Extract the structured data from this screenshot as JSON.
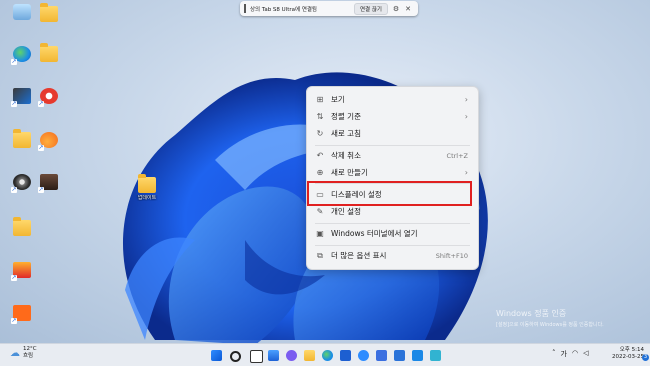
{
  "notification": {
    "text": "상의 Tab S8 Ultra에 연결됨",
    "connect_button": "연결 끊기",
    "settings_icon": "gear-icon",
    "close_icon": "close-icon"
  },
  "desktop": {
    "folder_label": "업데이트"
  },
  "context_menu": {
    "items": [
      {
        "label": "보기",
        "icon": "grid-icon",
        "submenu": true,
        "shortcut": ""
      },
      {
        "label": "정렬 기준",
        "icon": "sort-icon",
        "submenu": true,
        "shortcut": ""
      },
      {
        "label": "새로 고침",
        "icon": "refresh-icon",
        "submenu": false,
        "shortcut": ""
      },
      {
        "label": "삭제 취소",
        "icon": "undo-icon",
        "submenu": false,
        "shortcut": "Ctrl+Z"
      },
      {
        "label": "새로 만들기",
        "icon": "new-icon",
        "submenu": true,
        "shortcut": ""
      },
      {
        "label": "디스플레이 설정",
        "icon": "display-icon",
        "submenu": false,
        "shortcut": ""
      },
      {
        "label": "개인 설정",
        "icon": "brush-icon",
        "submenu": false,
        "shortcut": ""
      },
      {
        "label": "Windows 터미널에서 열기",
        "icon": "terminal-icon",
        "submenu": false,
        "shortcut": ""
      },
      {
        "label": "더 많은 옵션 표시",
        "icon": "more-options-icon",
        "submenu": false,
        "shortcut": "Shift+F10"
      }
    ],
    "highlight_color": "#e02020"
  },
  "watermark": {
    "title": "Windows 정품 인증",
    "subtitle": "[설정]으로 이동하여 Windows를 정품 인증합니다."
  },
  "taskbar": {
    "weather_temp": "12°C",
    "weather_desc": "흐림",
    "clock_time": "오후 5:14",
    "clock_date": "2022-03-25",
    "notification_count": "3",
    "accent": "#1f6fd6"
  }
}
